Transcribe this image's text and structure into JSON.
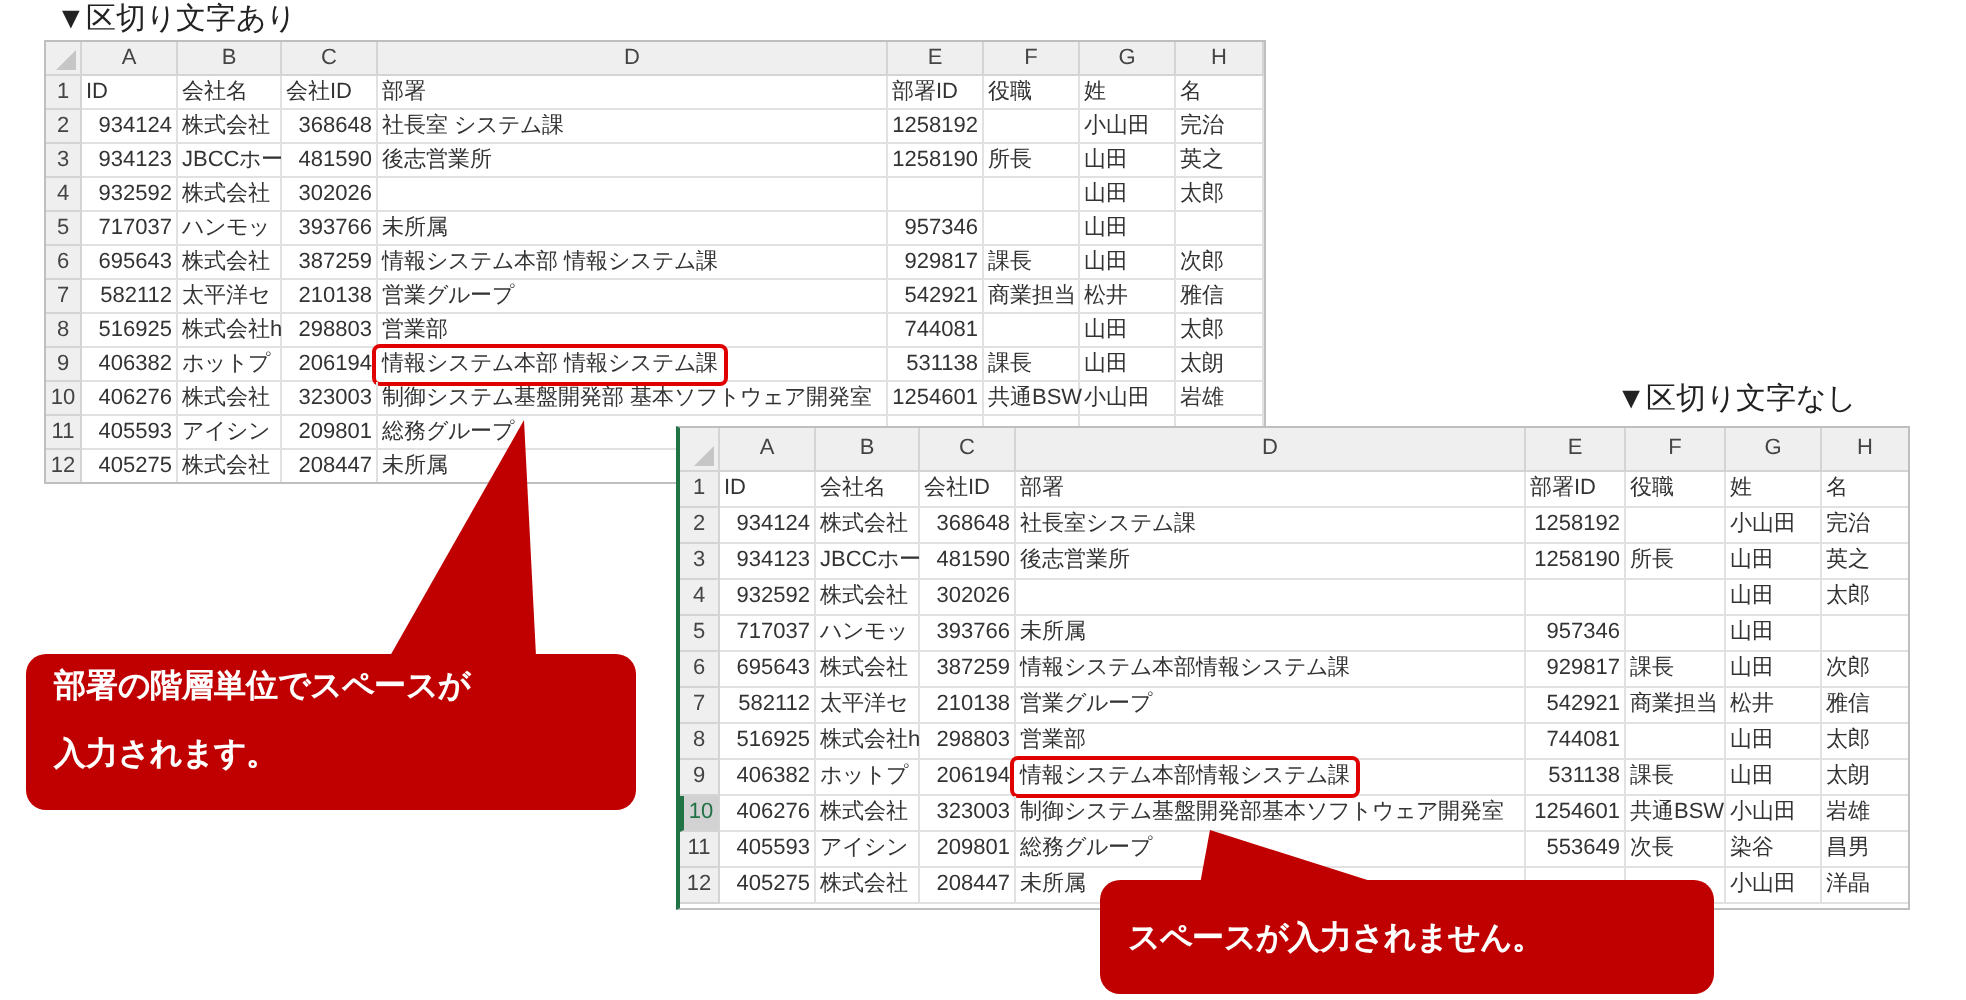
{
  "left_sheet": {
    "title": "▼区切り文字あり",
    "columns": [
      "A",
      "B",
      "C",
      "D",
      "E",
      "F",
      "G",
      "H"
    ],
    "rows": [
      {
        "number": "1",
        "selected": false,
        "highlighted": false,
        "cells": {
          "A": "ID",
          "B": "会社名",
          "C": "会社ID",
          "D": "部署",
          "E": "部署ID",
          "F": "役職",
          "G": "姓",
          "H": "名"
        }
      },
      {
        "number": "2",
        "selected": false,
        "highlighted": false,
        "cells": {
          "A": "934124",
          "B": "株式会社",
          "C": "368648",
          "D": "社長室 システム課",
          "E": "1258192",
          "G": "小山田",
          "H": "完治"
        }
      },
      {
        "number": "3",
        "selected": false,
        "highlighted": false,
        "cells": {
          "A": "934123",
          "B": "JBCCホー",
          "C": "481590",
          "D": "後志営業所",
          "E": "1258190",
          "F": "所長",
          "G": "山田",
          "H": "英之"
        }
      },
      {
        "number": "4",
        "selected": false,
        "highlighted": false,
        "cells": {
          "A": "932592",
          "B": "株式会社",
          "C": "302026",
          "G": "山田",
          "H": "太郎"
        }
      },
      {
        "number": "5",
        "selected": false,
        "highlighted": false,
        "cells": {
          "A": "717037",
          "B": "ハンモッ",
          "C": "393766",
          "D": "未所属",
          "E": "957346",
          "G": "山田"
        }
      },
      {
        "number": "6",
        "selected": false,
        "highlighted": false,
        "cells": {
          "A": "695643",
          "B": "株式会社",
          "C": "387259",
          "D": "情報システム本部 情報システム課",
          "E": "929817",
          "F": "課長",
          "G": "山田",
          "H": "次郎"
        }
      },
      {
        "number": "7",
        "selected": false,
        "highlighted": false,
        "cells": {
          "A": "582112",
          "B": "太平洋セ",
          "C": "210138",
          "D": "営業グループ",
          "E": "542921",
          "F": "商業担当",
          "G": "松井",
          "H": "雅信"
        }
      },
      {
        "number": "8",
        "selected": false,
        "highlighted": false,
        "cells": {
          "A": "516925",
          "B": "株式会社h",
          "C": "298803",
          "D": "営業部",
          "E": "744081",
          "G": "山田",
          "H": "太郎"
        }
      },
      {
        "number": "9",
        "selected": false,
        "highlighted": true,
        "cells": {
          "A": "406382",
          "B": "ホットプ",
          "C": "206194",
          "D": "情報システム本部 情報システム課",
          "E": "531138",
          "F": "課長",
          "G": "山田",
          "H": "太朗"
        }
      },
      {
        "number": "10",
        "selected": false,
        "highlighted": false,
        "cells": {
          "A": "406276",
          "B": "株式会社",
          "C": "323003",
          "D": "制御システム基盤開発部 基本ソフトウェア開発室",
          "E": "1254601",
          "F": "共通BSW",
          "G": "小山田",
          "H": "岩雄"
        }
      },
      {
        "number": "11",
        "selected": false,
        "highlighted": false,
        "cells": {
          "A": "405593",
          "B": "アイシン",
          "C": "209801",
          "D": "総務グループ"
        }
      },
      {
        "number": "12",
        "selected": false,
        "highlighted": false,
        "cells": {
          "A": "405275",
          "B": "株式会社",
          "C": "208447",
          "D": "未所属"
        }
      }
    ]
  },
  "right_sheet": {
    "title": "▼区切り文字なし",
    "columns": [
      "A",
      "B",
      "C",
      "D",
      "E",
      "F",
      "G",
      "H"
    ],
    "rows": [
      {
        "number": "1",
        "selected": false,
        "highlighted": false,
        "cells": {
          "A": "ID",
          "B": "会社名",
          "C": "会社ID",
          "D": "部署",
          "E": "部署ID",
          "F": "役職",
          "G": "姓",
          "H": "名"
        }
      },
      {
        "number": "2",
        "selected": false,
        "highlighted": false,
        "cells": {
          "A": "934124",
          "B": "株式会社",
          "C": "368648",
          "D": "社長室システム課",
          "E": "1258192",
          "G": "小山田",
          "H": "完治"
        }
      },
      {
        "number": "3",
        "selected": false,
        "highlighted": false,
        "cells": {
          "A": "934123",
          "B": "JBCCホー",
          "C": "481590",
          "D": "後志営業所",
          "E": "1258190",
          "F": "所長",
          "G": "山田",
          "H": "英之"
        }
      },
      {
        "number": "4",
        "selected": false,
        "highlighted": false,
        "cells": {
          "A": "932592",
          "B": "株式会社",
          "C": "302026",
          "G": "山田",
          "H": "太郎"
        }
      },
      {
        "number": "5",
        "selected": false,
        "highlighted": false,
        "cells": {
          "A": "717037",
          "B": "ハンモッ",
          "C": "393766",
          "D": "未所属",
          "E": "957346",
          "G": "山田"
        }
      },
      {
        "number": "6",
        "selected": false,
        "highlighted": false,
        "cells": {
          "A": "695643",
          "B": "株式会社",
          "C": "387259",
          "D": "情報システム本部情報システム課",
          "E": "929817",
          "F": "課長",
          "G": "山田",
          "H": "次郎"
        }
      },
      {
        "number": "7",
        "selected": false,
        "highlighted": false,
        "cells": {
          "A": "582112",
          "B": "太平洋セ",
          "C": "210138",
          "D": "営業グループ",
          "E": "542921",
          "F": "商業担当",
          "G": "松井",
          "H": "雅信"
        }
      },
      {
        "number": "8",
        "selected": false,
        "highlighted": false,
        "cells": {
          "A": "516925",
          "B": "株式会社h",
          "C": "298803",
          "D": "営業部",
          "E": "744081",
          "G": "山田",
          "H": "太郎"
        }
      },
      {
        "number": "9",
        "selected": false,
        "highlighted": true,
        "cells": {
          "A": "406382",
          "B": "ホットプ",
          "C": "206194",
          "D": "情報システム本部情報システム課",
          "E": "531138",
          "F": "課長",
          "G": "山田",
          "H": "太朗"
        }
      },
      {
        "number": "10",
        "selected": true,
        "highlighted": false,
        "cells": {
          "A": "406276",
          "B": "株式会社",
          "C": "323003",
          "D": "制御システム基盤開発部基本ソフトウェア開発室",
          "E": "1254601",
          "F": "共通BSW",
          "G": "小山田",
          "H": "岩雄"
        }
      },
      {
        "number": "11",
        "selected": false,
        "highlighted": false,
        "cells": {
          "A": "405593",
          "B": "アイシン",
          "C": "209801",
          "D": "総務グループ",
          "E": "553649",
          "F": "次長",
          "G": "染谷",
          "H": "昌男"
        }
      },
      {
        "number": "12",
        "selected": false,
        "highlighted": false,
        "cells": {
          "A": "405275",
          "B": "株式会社",
          "C": "208447",
          "D": "未所属",
          "G": "小山田",
          "H": "洋晶"
        }
      }
    ]
  },
  "callouts": [
    {
      "lines": [
        "部署の階層単位でスペースが",
        "入力されます。"
      ]
    },
    {
      "lines": [
        "スペースが入力されません。"
      ]
    }
  ]
}
